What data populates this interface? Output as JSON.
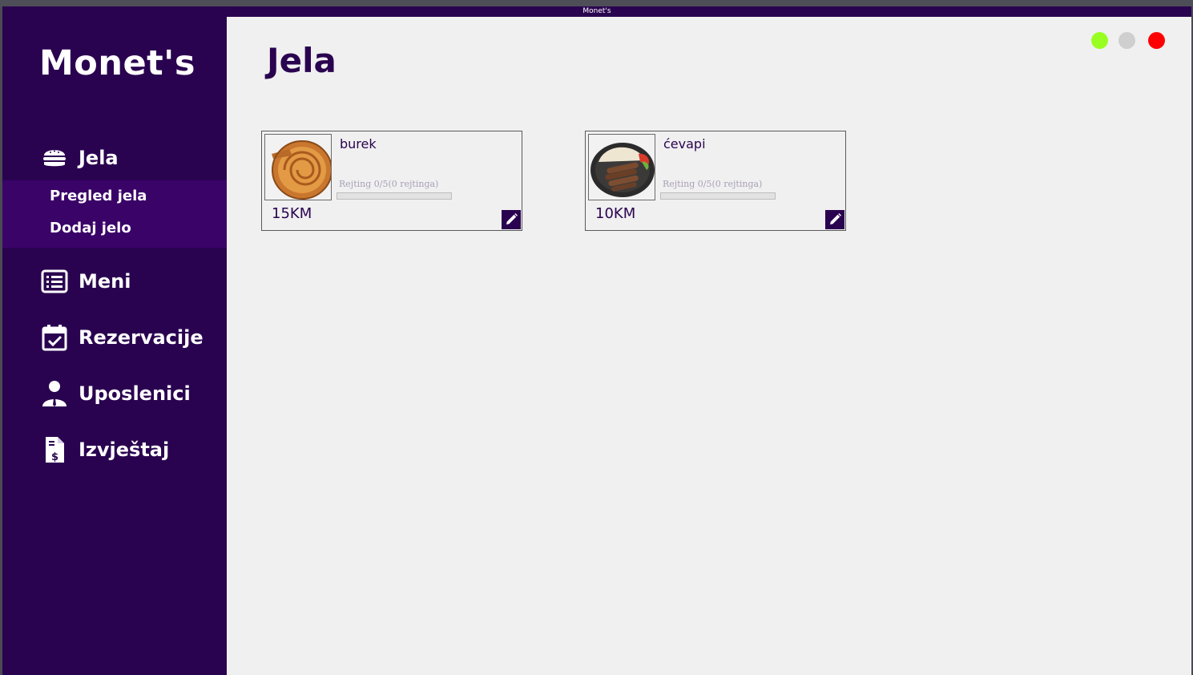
{
  "window": {
    "title": "Monet's"
  },
  "sidebar": {
    "brand": "Monet's",
    "items": [
      {
        "label": "Jela",
        "icon": "burger-icon"
      },
      {
        "label": "Meni",
        "icon": "list-icon"
      },
      {
        "label": "Rezervacije",
        "icon": "calendar-check-icon"
      },
      {
        "label": "Uposlenici",
        "icon": "employee-icon"
      },
      {
        "label": "Izvještaj",
        "icon": "invoice-icon"
      }
    ],
    "submenu": [
      {
        "label": "Pregled jela"
      },
      {
        "label": "Dodaj jelo"
      }
    ]
  },
  "main": {
    "title": "Jela",
    "window_controls": [
      {
        "name": "minimize",
        "color": "#99ff22"
      },
      {
        "name": "maximize",
        "color": "#cfcfcf"
      },
      {
        "name": "close",
        "color": "#ff0000"
      }
    ],
    "dishes": [
      {
        "name": "burek",
        "rating": "Rejting 0/5(0 rejtinga)",
        "rating_fraction": 0,
        "price": "15KM",
        "image": "burek-photo"
      },
      {
        "name": "ćevapi",
        "rating": "Rejting 0/5(0 rejtinga)",
        "rating_fraction": 0,
        "price": "10KM",
        "image": "cevapi-photo"
      }
    ]
  },
  "colors": {
    "sidebar_bg": "#2a0350",
    "submenu_bg": "#3a0368",
    "content_bg": "#f0f0f0",
    "accent": "#2a0350"
  }
}
